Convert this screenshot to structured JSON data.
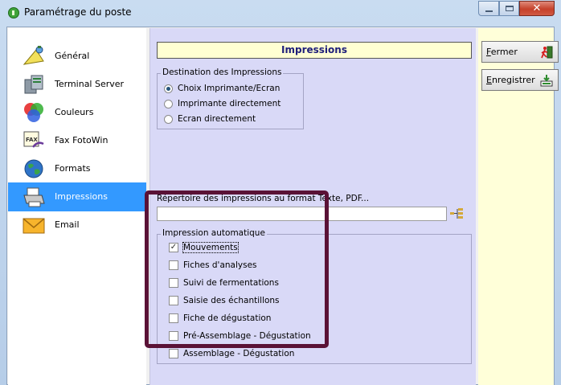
{
  "window": {
    "title": "Paramétrage du poste"
  },
  "sidebar": {
    "items": [
      {
        "label": "Général",
        "icon": "general-icon"
      },
      {
        "label": "Terminal Server",
        "icon": "terminal-server-icon"
      },
      {
        "label": "Couleurs",
        "icon": "colors-icon"
      },
      {
        "label": "Fax FotoWin",
        "icon": "fax-icon"
      },
      {
        "label": "Formats",
        "icon": "globe-icon"
      },
      {
        "label": "Impressions",
        "icon": "printer-icon",
        "selected": true
      },
      {
        "label": "Email",
        "icon": "envelope-icon"
      }
    ]
  },
  "main": {
    "header": "Impressions",
    "destination": {
      "title": "Destination des Impressions",
      "options": [
        {
          "label": "Choix Imprimante/Ecran",
          "checked": true
        },
        {
          "label": "Imprimante directement",
          "checked": false
        },
        {
          "label": "Ecran directement",
          "checked": false
        }
      ]
    },
    "directory": {
      "label": "Répertoire des impressions au format Texte, PDF...",
      "value": ""
    },
    "auto": {
      "title": "Impression automatique",
      "items": [
        {
          "label": "Mouvements",
          "checked": true
        },
        {
          "label": "Fiches d'analyses",
          "checked": false
        },
        {
          "label": "Suivi de fermentations",
          "checked": false
        },
        {
          "label": "Saisie des échantillons",
          "checked": false
        },
        {
          "label": "Fiche de dégustation",
          "checked": false
        },
        {
          "label": "Pré-Assemblage - Dégustation",
          "checked": false
        },
        {
          "label": "Assemblage - Dégustation",
          "checked": false
        }
      ]
    }
  },
  "buttons": {
    "close": {
      "mnemonic": "F",
      "rest": "ermer",
      "icon": "exit-icon"
    },
    "save": {
      "mnemonic": "E",
      "rest": "nregistrer",
      "icon": "save-icon"
    }
  },
  "colors": {
    "selection": "#3399ff",
    "panel": "#d9d9f7",
    "header_bg": "#ffffd2",
    "button_column": "#ffffd9",
    "highlight_frame": "#5a1236"
  }
}
